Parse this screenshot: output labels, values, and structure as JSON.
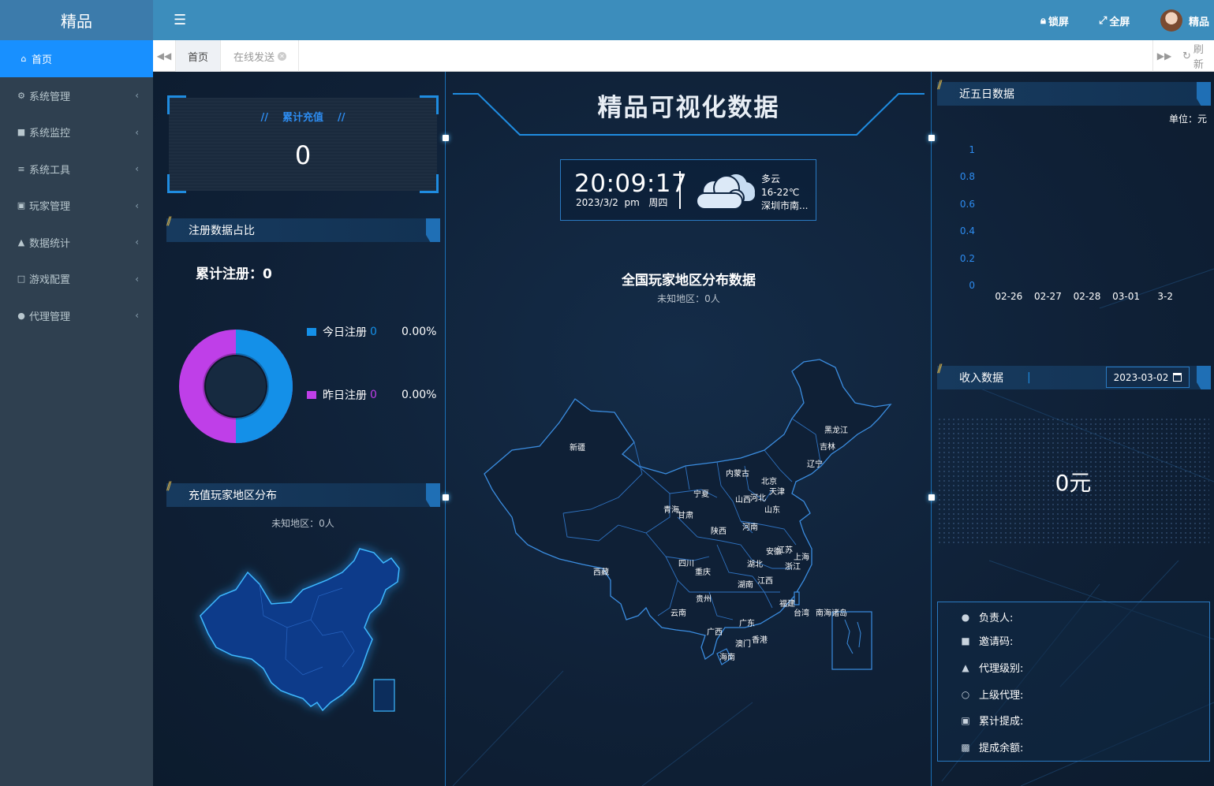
{
  "app": {
    "logo": "精品"
  },
  "sidebar": {
    "items": [
      {
        "label": "首页",
        "icon": "home-icon",
        "active": true
      },
      {
        "label": "系统管理",
        "icon": "gear-icon"
      },
      {
        "label": "系统监控",
        "icon": "video-icon"
      },
      {
        "label": "系统工具",
        "icon": "bars-icon"
      },
      {
        "label": "玩家管理",
        "icon": "user-card-icon"
      },
      {
        "label": "数据统计",
        "icon": "area-chart-icon"
      },
      {
        "label": "游戏配置",
        "icon": "monitor-icon"
      },
      {
        "label": "代理管理",
        "icon": "users-icon"
      }
    ]
  },
  "header": {
    "lock_label": "锁屏",
    "fullscreen_label": "全屏",
    "user_name": "精品"
  },
  "tabs": {
    "items": [
      "首页",
      "在线发送"
    ],
    "refresh_label": "刷新"
  },
  "dashboard": {
    "title": "精品可视化数据",
    "recharge": {
      "label": "累计充值",
      "value": "0"
    },
    "register": {
      "title": "注册数据占比",
      "total_label": "累计注册：0",
      "today_label": "今日注册",
      "today_value": "0",
      "today_pct": "0.00%",
      "yesterday_label": "昨日注册",
      "yesterday_value": "0",
      "yesterday_pct": "0.00%"
    },
    "recharge_region": {
      "title": "充值玩家地区分布",
      "unknown": "未知地区：0人"
    },
    "national": {
      "title": "全国玩家地区分布数据",
      "unknown": "未知地区：0人"
    },
    "clock": {
      "time": "20:09:17",
      "date": "2023/3/2",
      "ampm": "pm",
      "weekday": "周四",
      "weather": "多云",
      "temp": "16-22℃",
      "city": "深圳市南..."
    },
    "five_day": {
      "title": "近五日数据",
      "unit": "单位：元"
    },
    "income": {
      "title": "收入数据",
      "date": "2023-03-02",
      "value": "0元"
    },
    "agent_info": {
      "owner": "负责人:",
      "invite": "邀请码:",
      "level": "代理级别:",
      "parent": "上级代理:",
      "total_commission": "累计提成:",
      "balance": "提成余额:"
    },
    "provinces": {
      "xinjiang": "新疆",
      "xizang": "西藏",
      "qinghai": "青海",
      "gansu": "甘肃",
      "ningxia": "宁夏",
      "neimenggu": "内蒙古",
      "heilongjiang": "黑龙江",
      "jilin": "吉林",
      "liaoning": "辽宁",
      "beijing": "北京",
      "tianjin": "天津",
      "hebei": "河北",
      "shanxi": "山西",
      "shandong": "山东",
      "henan": "河南",
      "shaanxi": "陕西",
      "sichuan": "四川",
      "chongqing": "重庆",
      "hubei": "湖北",
      "anhui": "安徽",
      "jiangsu": "江苏",
      "shanghai": "上海",
      "zhejiang": "浙江",
      "hunan": "湖南",
      "jiangxi": "江西",
      "guizhou": "贵州",
      "yunnan": "云南",
      "guangxi": "广西",
      "guangdong": "广东",
      "fujian": "福建",
      "taiwan": "台湾",
      "nanhai": "南海诸岛",
      "xianggang": "香港",
      "aomen": "澳门",
      "hainan": "海南"
    }
  },
  "chart_data": {
    "type": "line",
    "categories": [
      "02-26",
      "02-27",
      "02-28",
      "03-01",
      "3-2"
    ],
    "series": [
      {
        "values": [
          0,
          0,
          0,
          0,
          0
        ]
      }
    ],
    "yticks": [
      "0",
      "0.2",
      "0.4",
      "0.6",
      "0.8",
      "1"
    ],
    "ylim": [
      0,
      1
    ],
    "ylabel": "",
    "xlabel": "",
    "title": ""
  },
  "colors": {
    "accent": "#1890ff",
    "sidebar": "#2f4050",
    "header": "#3c8dbc",
    "today": "#1490e8",
    "yesterday": "#bf3fe8"
  }
}
